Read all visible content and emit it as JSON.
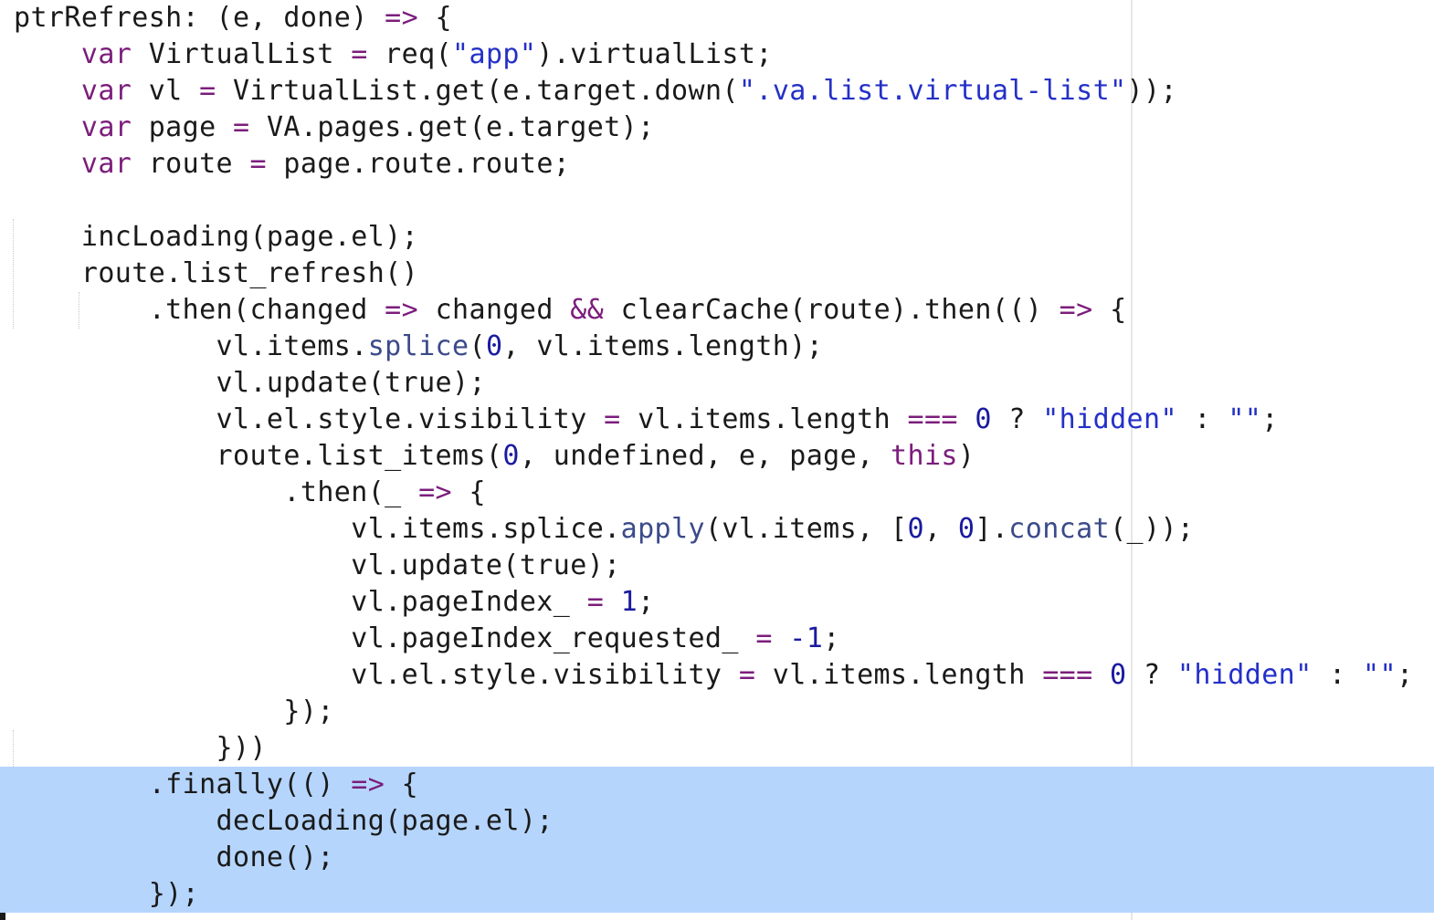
{
  "editor": {
    "lines": [
      {
        "indent": 0,
        "tokens": [
          [
            "ptrRefresh: (e, done) ",
            ""
          ],
          [
            "=>",
            "op"
          ],
          [
            " {",
            ""
          ]
        ]
      },
      {
        "indent": 1,
        "tokens": [
          [
            "var",
            "kw"
          ],
          [
            " VirtualList ",
            ""
          ],
          [
            "=",
            "op"
          ],
          [
            " req(",
            ""
          ],
          [
            "\"app\"",
            "str"
          ],
          [
            ").virtualList;",
            ""
          ]
        ]
      },
      {
        "indent": 1,
        "tokens": [
          [
            "var",
            "kw"
          ],
          [
            " vl ",
            ""
          ],
          [
            "=",
            "op"
          ],
          [
            " VirtualList.get(e.target.down(",
            ""
          ],
          [
            "\".va.list.virtual-list\"",
            "str"
          ],
          [
            "));",
            ""
          ]
        ]
      },
      {
        "indent": 1,
        "tokens": [
          [
            "var",
            "kw"
          ],
          [
            " page ",
            ""
          ],
          [
            "=",
            "op"
          ],
          [
            " VA.pages.get(e.target);",
            ""
          ]
        ]
      },
      {
        "indent": 1,
        "tokens": [
          [
            "var",
            "kw"
          ],
          [
            " route ",
            ""
          ],
          [
            "=",
            "op"
          ],
          [
            " page.route.route;",
            ""
          ]
        ]
      },
      {
        "indent": 0,
        "tokens": []
      },
      {
        "indent": 1,
        "tokens": [
          [
            "incLoading(page.el);",
            ""
          ]
        ]
      },
      {
        "indent": 1,
        "tokens": [
          [
            "route.list_refresh()",
            ""
          ]
        ]
      },
      {
        "indent": 2,
        "tokens": [
          [
            ".then(changed ",
            ""
          ],
          [
            "=>",
            "op"
          ],
          [
            " changed ",
            ""
          ],
          [
            "&&",
            "op"
          ],
          [
            " clearCache(route).then(() ",
            ""
          ],
          [
            "=>",
            "op"
          ],
          [
            " {",
            ""
          ]
        ]
      },
      {
        "indent": 3,
        "tokens": [
          [
            "vl.items.",
            ""
          ],
          [
            "splice",
            "fn"
          ],
          [
            "(",
            ""
          ],
          [
            "0",
            "num"
          ],
          [
            ", vl.items.length);",
            ""
          ]
        ]
      },
      {
        "indent": 3,
        "tokens": [
          [
            "vl.update(true);",
            ""
          ]
        ]
      },
      {
        "indent": 3,
        "tokens": [
          [
            "vl.el.style.visibility ",
            ""
          ],
          [
            "=",
            "op"
          ],
          [
            " vl.items.length ",
            ""
          ],
          [
            "===",
            "op"
          ],
          [
            " ",
            ""
          ],
          [
            "0",
            "num"
          ],
          [
            " ? ",
            ""
          ],
          [
            "\"hidden\"",
            "str"
          ],
          [
            " : ",
            ""
          ],
          [
            "\"\"",
            "str"
          ],
          [
            ";",
            ""
          ]
        ]
      },
      {
        "indent": 3,
        "tokens": [
          [
            "route.list_items(",
            ""
          ],
          [
            "0",
            "num"
          ],
          [
            ", undefined, e, page, ",
            ""
          ],
          [
            "this",
            "kw"
          ],
          [
            ")",
            ""
          ]
        ]
      },
      {
        "indent": 4,
        "tokens": [
          [
            ".then(_ ",
            ""
          ],
          [
            "=>",
            "op"
          ],
          [
            " {",
            ""
          ]
        ]
      },
      {
        "indent": 5,
        "tokens": [
          [
            "vl.items.splice.",
            ""
          ],
          [
            "apply",
            "fn"
          ],
          [
            "(vl.items, [",
            ""
          ],
          [
            "0",
            "num"
          ],
          [
            ", ",
            ""
          ],
          [
            "0",
            "num"
          ],
          [
            "].",
            ""
          ],
          [
            "concat",
            "fn"
          ],
          [
            "(_));",
            ""
          ]
        ]
      },
      {
        "indent": 5,
        "tokens": [
          [
            "vl.update(true);",
            ""
          ]
        ]
      },
      {
        "indent": 5,
        "tokens": [
          [
            "vl.pageIndex_ ",
            ""
          ],
          [
            "=",
            "op"
          ],
          [
            " ",
            ""
          ],
          [
            "1",
            "num"
          ],
          [
            ";",
            ""
          ]
        ]
      },
      {
        "indent": 5,
        "tokens": [
          [
            "vl.pageIndex_requested_ ",
            ""
          ],
          [
            "=",
            "op"
          ],
          [
            " ",
            ""
          ],
          [
            "-1",
            "num"
          ],
          [
            ";",
            ""
          ]
        ]
      },
      {
        "indent": 5,
        "tokens": [
          [
            "vl.el.style.visibility ",
            ""
          ],
          [
            "=",
            "op"
          ],
          [
            " vl.items.length ",
            ""
          ],
          [
            "===",
            "op"
          ],
          [
            " ",
            ""
          ],
          [
            "0",
            "num"
          ],
          [
            " ? ",
            ""
          ],
          [
            "\"hidden\"",
            "str"
          ],
          [
            " : ",
            ""
          ],
          [
            "\"\"",
            "str"
          ],
          [
            ";",
            ""
          ]
        ]
      },
      {
        "indent": 4,
        "tokens": [
          [
            "});",
            ""
          ]
        ]
      },
      {
        "indent": 3,
        "tokens": [
          [
            "}))",
            ""
          ]
        ]
      },
      {
        "indent": 2,
        "selected": true,
        "tokens": [
          [
            ".finally(() ",
            ""
          ],
          [
            "=>",
            "op"
          ],
          [
            " {",
            ""
          ]
        ]
      },
      {
        "indent": 3,
        "selected": true,
        "tokens": [
          [
            "decLoading(page.el);",
            ""
          ]
        ]
      },
      {
        "indent": 3,
        "selected": true,
        "tokens": [
          [
            "done();",
            ""
          ]
        ]
      },
      {
        "indent": 2,
        "selected": true,
        "tokens": [
          [
            "});",
            ""
          ]
        ]
      }
    ]
  },
  "colors": {
    "background": "#ffffff",
    "selection": "#b5d5fd",
    "keyword": "#7b1d7b",
    "string": "#2430c8",
    "number": "#1a1aa0",
    "function": "#3b4a8a",
    "text": "#1a1a1a",
    "margin_guide": "#e7e7e7"
  }
}
